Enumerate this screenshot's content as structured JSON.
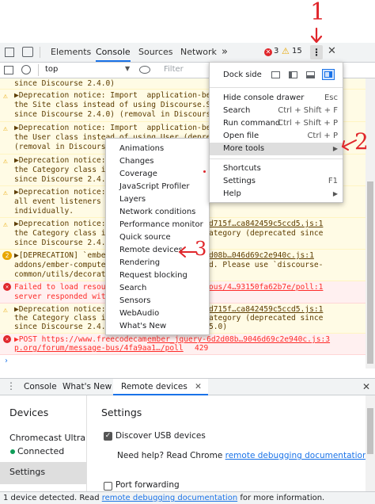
{
  "annotations": {
    "mark_1": "1",
    "mark_2": "2",
    "mark_3": "3"
  },
  "tabs": [
    {
      "label": "Elements"
    },
    {
      "label": "Console"
    },
    {
      "label": "Sources"
    },
    {
      "label": "Network"
    }
  ],
  "more_tabs": "»",
  "counts": {
    "errors": "3",
    "warnings": "15"
  },
  "toolbar": {
    "context": "top",
    "filter_placeholder": "Filter"
  },
  "log": [
    {
      "lines": [
        "since Discourse 2.4.0)"
      ]
    },
    {
      "lines": [
        "▶Deprecation notice: Import  application-be4",
        "the Site class instead of using Discourse.Site",
        "since Discourse 2.4.0) (removal in Discourse 2.6.0)"
      ]
    },
    {
      "lines": [
        "▶Deprecation notice: Import  application-be4",
        "the User class instead of using User (deprecat",
        "(removal in Discourse 2.6.0)"
      ]
    },
    {
      "lines": [
        "▶Deprecation notice: Import",
        "the Category class in",
        "since Discourse 2.4.0)"
      ]
    },
    {
      "lines": [
        "▶Deprecation notice: Imp",
        "all event listeners a",
        "individually."
      ]
    },
    {
      "lines": [
        "▶Deprecation notice: Imp",
        "the Category class in",
        "since Discourse 2.4.0)"
      ],
      "right": [
        "d715f…ca842459c5ccd5.js:1",
        "ategory (deprecated since",
        ""
      ]
    },
    {
      "badge": "2",
      "lines": [
        "▶[DEPRECATION] `embe",
        "addons/ember-computed",
        "common/utils/decorato"
      ],
      "right": [
        "d08b…046d69c2e940c.js:1",
        "d. Please use `discourse-",
        ""
      ]
    },
    {
      "lines": [
        "Failed to load resour",
        "server responded with"
      ],
      "right": [
        "ous/4…93150fa62b7e/poll:1",
        ""
      ]
    },
    {
      "lines": [
        "▶Deprecation notice: Imp",
        "the Category class in",
        "since Discourse 2.4.0"
      ],
      "right": [
        "d715f…ca842459c5ccd5.js:1",
        "ategory (deprecated since",
        "5.0)"
      ]
    },
    {
      "lines": [
        "▶POST https://www.freecodecam",
        "p.org/forum/message-bus/4fa9aa1…/poll"
      ],
      "right": [
        "ember_jquery-6d2d08b…9046d69c2e940c.js:3",
        "429"
      ]
    }
  ],
  "prompt": "›",
  "main_menu": {
    "dock_side": "Dock side",
    "items": [
      {
        "label": "Hide console drawer",
        "shortcut": "Esc"
      },
      {
        "label": "Search",
        "shortcut": "Ctrl + Shift + F"
      },
      {
        "label": "Run command",
        "shortcut": "Ctrl + Shift + P"
      },
      {
        "label": "Open file",
        "shortcut": "Ctrl + P"
      },
      {
        "label": "More tools",
        "shortcut": "▶"
      },
      {
        "label": "Shortcuts",
        "shortcut": ""
      },
      {
        "label": "Settings",
        "shortcut": "F1"
      },
      {
        "label": "Help",
        "shortcut": "▶"
      }
    ]
  },
  "tools_menu": [
    "Animations",
    "Changes",
    "Coverage",
    "JavaScript Profiler",
    "Layers",
    "Network conditions",
    "Performance monitor",
    "Quick source",
    "Remote devices",
    "Rendering",
    "Request blocking",
    "Search",
    "Sensors",
    "WebAudio",
    "What's New"
  ],
  "drawer": {
    "tabs": [
      "Console",
      "What's New",
      "Remote devices"
    ],
    "devices_heading": "Devices",
    "device_name": "Chromecast Ultra",
    "device_status": "Connected",
    "settings_nav": "Settings",
    "settings_heading": "Settings",
    "discover_usb": "Discover USB devices",
    "help_prefix": "Need help? Read Chrome ",
    "help_link": "remote debugging documentation",
    "help_suffix": ".",
    "port_forwarding": "Port forwarding"
  },
  "status": {
    "prefix": "1 device detected. Read ",
    "link": "remote debugging documentation",
    "suffix": " for more information."
  },
  "colors": {
    "accent": "#1a73e8",
    "annotation": "#e0262b",
    "warn_bg": "#fffbe5",
    "error_bg": "#fff0f0"
  }
}
